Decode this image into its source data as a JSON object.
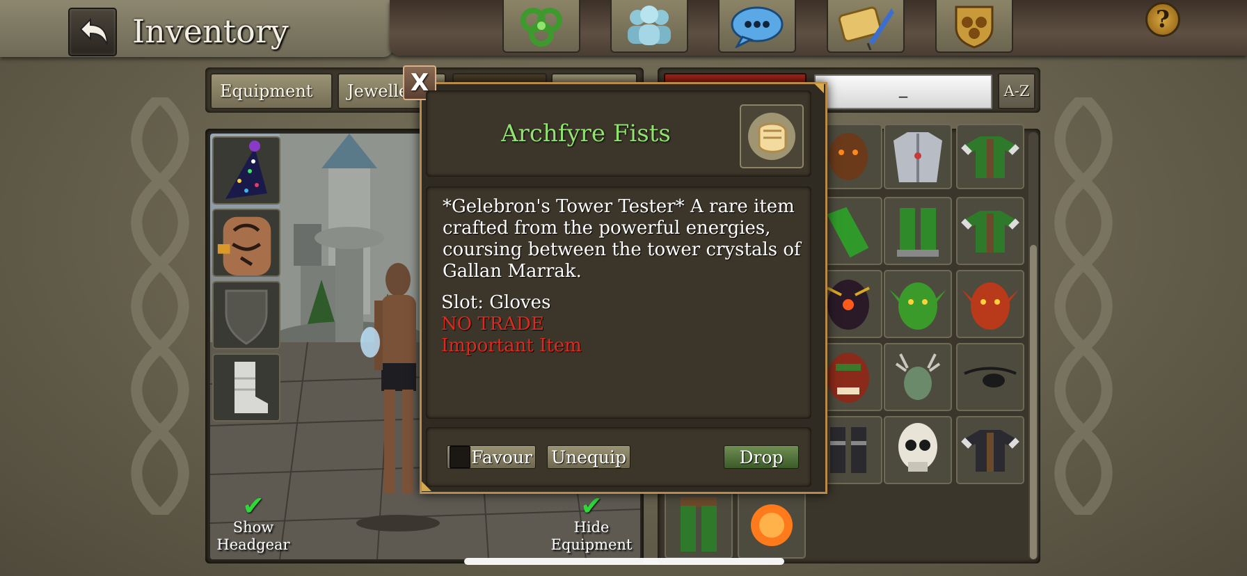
{
  "header": {
    "title": "Inventory",
    "back_icon": "back-arrow-icon",
    "nav_icons": [
      "triskelion-icon",
      "party-icon",
      "chat-icon",
      "quest-scroll-icon",
      "guild-crest-icon"
    ],
    "help_label": "?"
  },
  "tabs": [
    {
      "label": "Equipment",
      "state": "normal"
    },
    {
      "label": "Jewellery",
      "state": "normal"
    },
    {
      "label": "",
      "state": "dark"
    },
    {
      "label": "",
      "state": "normal"
    }
  ],
  "filter": {
    "search_value": "_",
    "sort_label": "A-Z"
  },
  "character": {
    "slots": [
      "party-hat-icon",
      "tattooed-chest-icon",
      "shield-slot-icon",
      "boot-slot-icon"
    ],
    "show_headgear_label": "Show\nHeadgear",
    "hide_equipment_label": "Hide\nEquipment",
    "show_headgear_checked": true,
    "hide_equipment_checked": true
  },
  "inventory": {
    "items": [
      "beast-mask-icon",
      "silver-armor-icon",
      "green-tunic-icon",
      "green-gloves-icon",
      "green-leggings-icon",
      "green-tunic-icon",
      "dark-mask-icon",
      "green-goblin-mask-icon",
      "red-goblin-mask-icon",
      "orc-mask-icon",
      "antler-helm-icon",
      "black-eyepatch-icon",
      "dark-boots-icon",
      "skull-mask-icon",
      "dark-tunic-icon",
      "green-pants-icon",
      "fire-fist-icon"
    ]
  },
  "dialog": {
    "close_label": "X",
    "item_name": "Archfyre Fists",
    "item_icon": "glowing-fist-icon",
    "description": "*Gelebron's Tower Tester* A rare item crafted from the powerful energies, coursing between the tower crystals of Gallan Marrak.",
    "slot_line": "Slot: Gloves",
    "flag_no_trade": "NO TRADE",
    "flag_important": "Important Item",
    "favour_label": "Favour",
    "unequip_label": "Unequip",
    "drop_label": "Drop",
    "colors": {
      "item_name": "#8fe36e",
      "flag": "#e02a1e",
      "border": "#b98a48"
    }
  }
}
